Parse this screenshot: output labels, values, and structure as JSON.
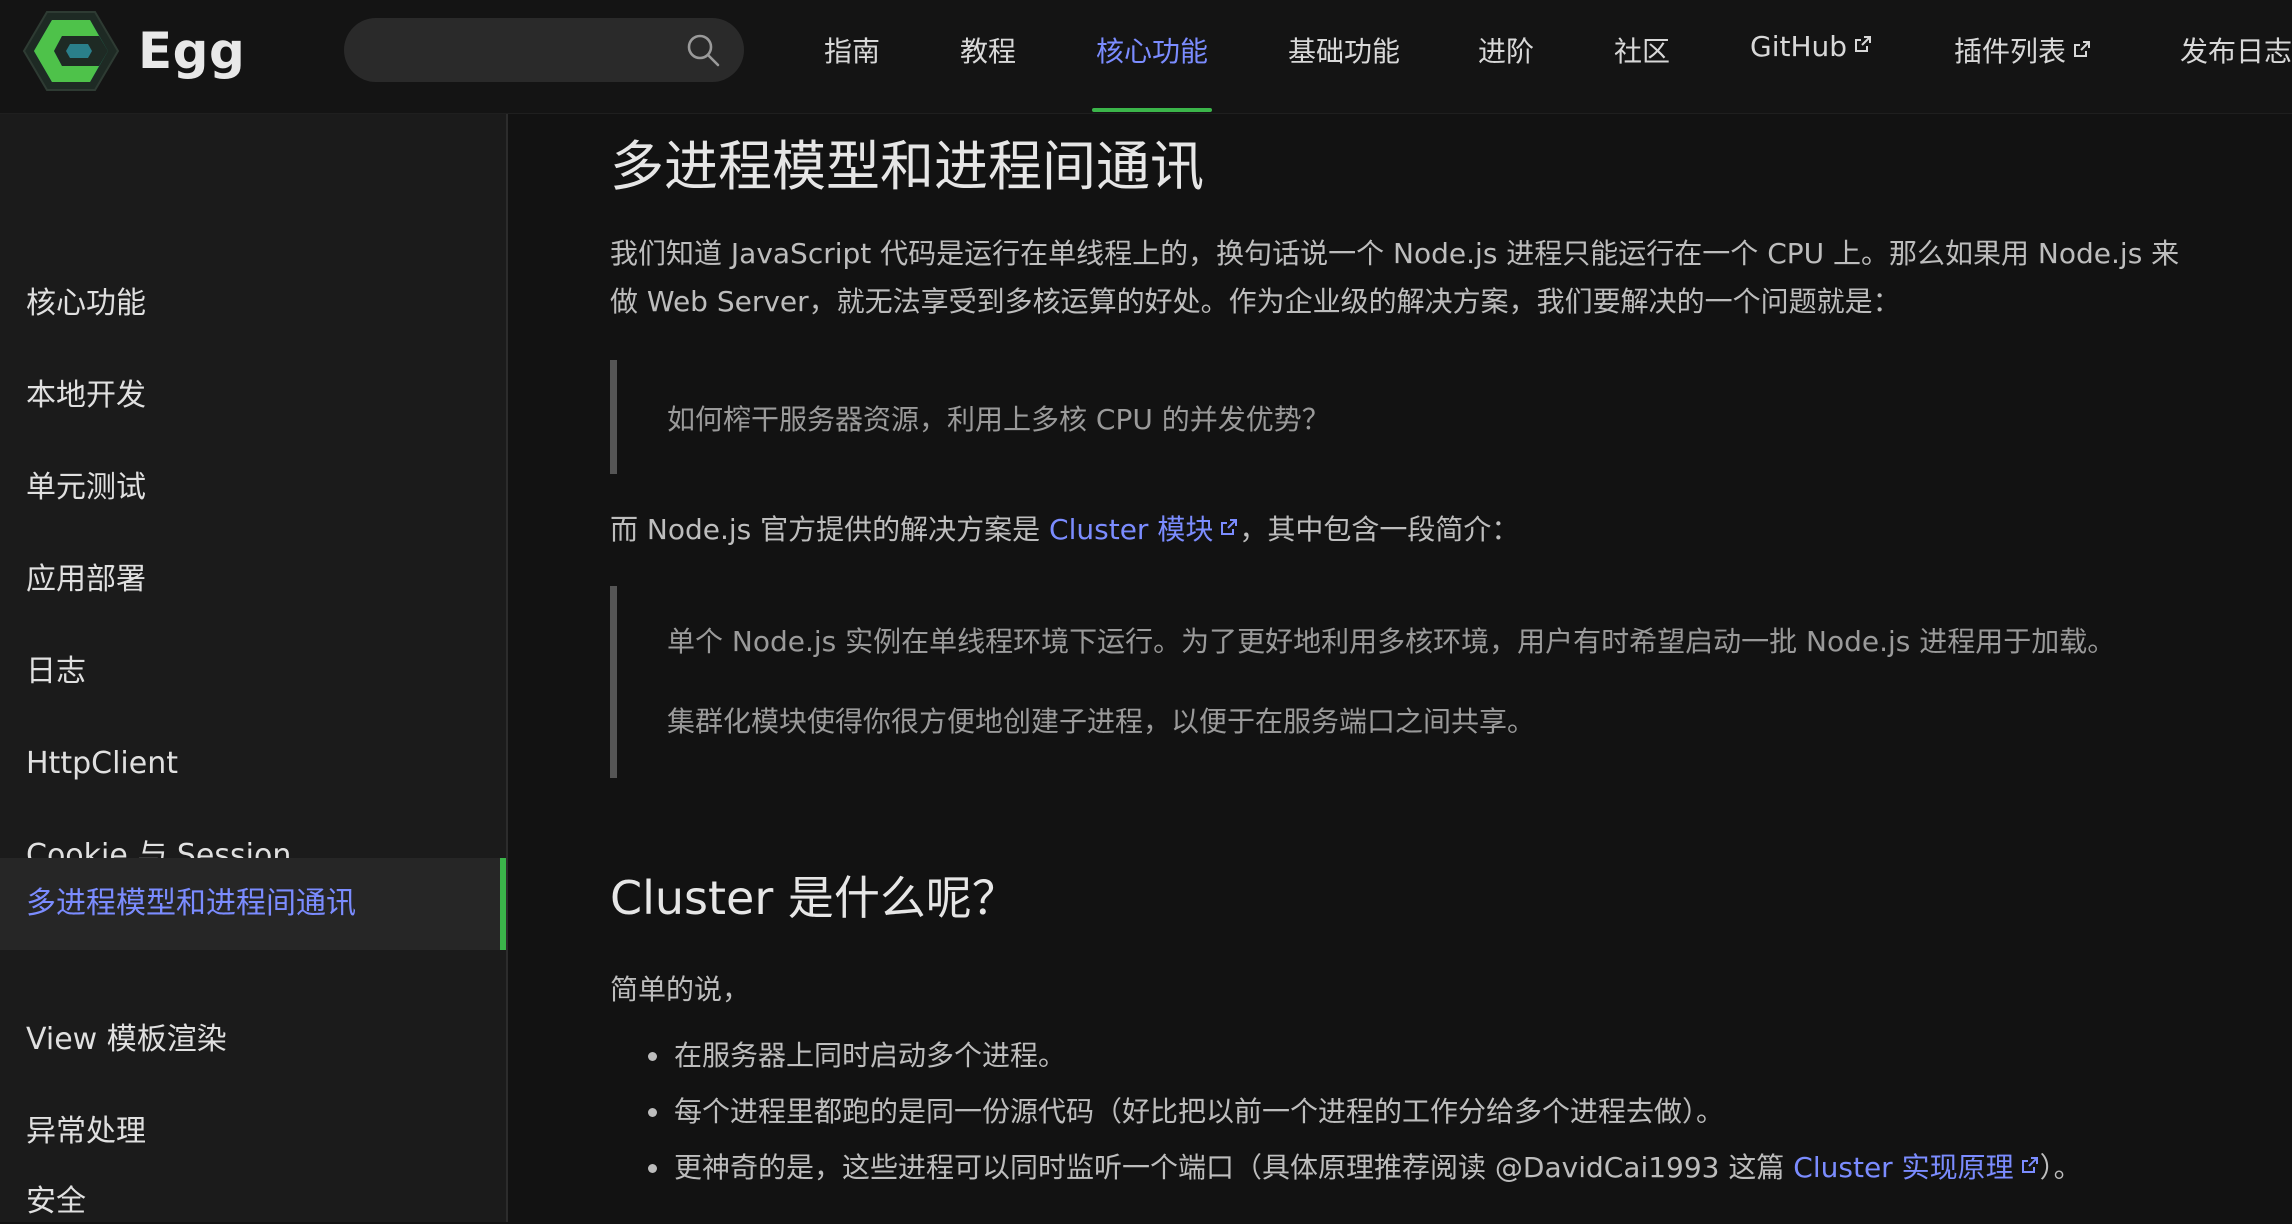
{
  "header": {
    "brand": "Egg",
    "search_placeholder": "",
    "nav": [
      {
        "label": "指南",
        "external": false
      },
      {
        "label": "教程",
        "external": false
      },
      {
        "label": "核心功能",
        "external": false,
        "active": true
      },
      {
        "label": "基础功能",
        "external": false
      },
      {
        "label": "进阶",
        "external": false
      },
      {
        "label": "社区",
        "external": false
      },
      {
        "label": "GitHub",
        "external": true
      },
      {
        "label": "插件列表",
        "external": true
      },
      {
        "label": "发布日志",
        "external": false
      }
    ]
  },
  "sidebar": {
    "items": [
      {
        "label": "核心功能"
      },
      {
        "label": "本地开发"
      },
      {
        "label": "单元测试"
      },
      {
        "label": "应用部署"
      },
      {
        "label": "日志"
      },
      {
        "label": "HttpClient"
      },
      {
        "label": "Cookie 与 Session"
      },
      {
        "label": "多进程模型和进程间通讯",
        "active": true
      },
      {
        "label": "View 模板渲染"
      },
      {
        "label": "异常处理"
      },
      {
        "label": "安全"
      }
    ]
  },
  "main": {
    "title": "多进程模型和进程间通讯",
    "intro_line1": "我们知道 JavaScript 代码是运行在单线程上的，换句话说一个 Node.js 进程只能运行在一个 CPU 上。那么如果用 Node.js 来",
    "intro_line2": "做 Web Server，就无法享受到多核运算的好处。作为企业级的解决方案，我们要解决的一个问题就是：",
    "quote1": "如何榨干服务器资源，利用上多核 CPU 的并发优势？",
    "para2_prefix": "而 Node.js 官方提供的解决方案是 ",
    "para2_link": "Cluster 模块",
    "para2_suffix": "，其中包含一段简介：",
    "quote2_line1": "单个 Node.js 实例在单线程环境下运行。为了更好地利用多核环境，用户有时希望启动一批 Node.js 进程用于加载。",
    "quote2_line2": "集群化模块使得你很方便地创建子进程，以便于在服务端口之间共享。",
    "section_title": "Cluster 是什么呢？",
    "section_intro": "简单的说，",
    "bullet1": "在服务器上同时启动多个进程。",
    "bullet2": "每个进程里都跑的是同一份源代码（好比把以前一个进程的工作分给多个进程去做）。",
    "bullet3_prefix": "更神奇的是，这些进程可以同时监听一个端口（具体原理推荐阅读 @DavidCai1993 这篇 ",
    "bullet3_link": "Cluster 实现原理",
    "bullet3_suffix": "）。"
  },
  "colors": {
    "accent": "#7b8cff",
    "brand_green": "#3bb54a",
    "background": "#121212",
    "sidebar_bg": "#1b1b1b"
  }
}
